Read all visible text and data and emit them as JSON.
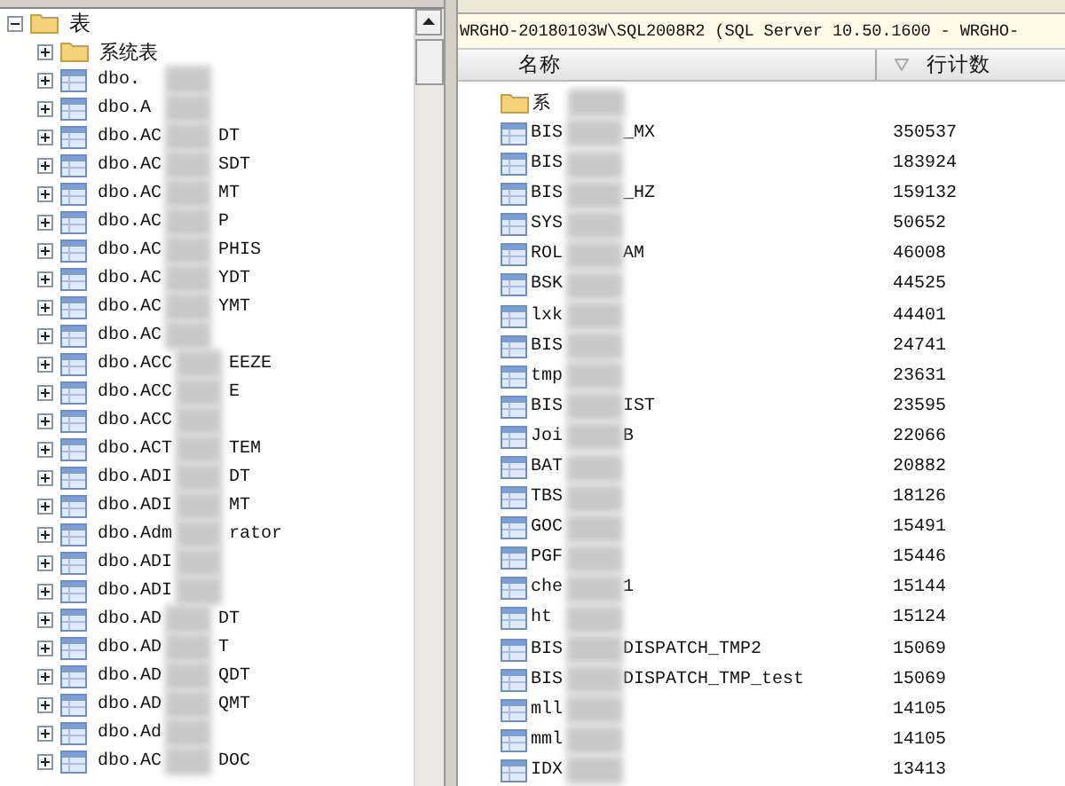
{
  "object_explorer": {
    "tree": [
      {
        "label": "表",
        "kind": "folder",
        "expanded": true,
        "children": [
          {
            "kind": "folder",
            "name_start": "系统表",
            "expanded": false
          },
          {
            "kind": "table",
            "name_start": "dbo.",
            "expanded": false
          },
          {
            "kind": "table",
            "name_start": "dbo.A",
            "expanded": false
          },
          {
            "kind": "table",
            "name_start": "dbo.AC",
            "name_end": "DT",
            "expanded": false
          },
          {
            "kind": "table",
            "name_start": "dbo.AC",
            "name_end": "SDT",
            "expanded": false
          },
          {
            "kind": "table",
            "name_start": "dbo.AC",
            "name_end": "MT",
            "expanded": false
          },
          {
            "kind": "table",
            "name_start": "dbo.AC",
            "name_end": "P",
            "expanded": false
          },
          {
            "kind": "table",
            "name_start": "dbo.AC",
            "name_end": "PHIS",
            "expanded": false
          },
          {
            "kind": "table",
            "name_start": "dbo.AC",
            "name_end": "YDT",
            "expanded": false
          },
          {
            "kind": "table",
            "name_start": "dbo.AC",
            "name_end": "YMT",
            "expanded": false
          },
          {
            "kind": "table",
            "name_start": "dbo.AC",
            "expanded": false
          },
          {
            "kind": "table",
            "name_start": "dbo.ACC",
            "name_end": "EEZE",
            "expanded": false
          },
          {
            "kind": "table",
            "name_start": "dbo.ACC",
            "name_end": "E",
            "expanded": false
          },
          {
            "kind": "table",
            "name_start": "dbo.ACC",
            "expanded": false
          },
          {
            "kind": "table",
            "name_start": "dbo.ACT",
            "name_end": "TEM",
            "expanded": false
          },
          {
            "kind": "table",
            "name_start": "dbo.ADI",
            "name_end": "DT",
            "expanded": false
          },
          {
            "kind": "table",
            "name_start": "dbo.ADI",
            "name_end": "MT",
            "expanded": false
          },
          {
            "kind": "table",
            "name_start": "dbo.Adm",
            "name_end": "rator",
            "expanded": false
          },
          {
            "kind": "table",
            "name_start": "dbo.ADI",
            "expanded": false
          },
          {
            "kind": "table",
            "name_start": "dbo.ADI",
            "expanded": false
          },
          {
            "kind": "table",
            "name_start": "dbo.AD",
            "name_end": "DT",
            "expanded": false
          },
          {
            "kind": "table",
            "name_start": "dbo.AD",
            "name_end": "T",
            "expanded": false
          },
          {
            "kind": "table",
            "name_start": "dbo.AD",
            "name_end": "QDT",
            "expanded": false
          },
          {
            "kind": "table",
            "name_start": "dbo.AD",
            "name_end": "QMT",
            "expanded": false
          },
          {
            "kind": "table",
            "name_start": "dbo.Ad",
            "expanded": false
          },
          {
            "kind": "table",
            "name_start": "dbo.AC",
            "name_end": "DOC",
            "expanded": false
          }
        ]
      }
    ]
  },
  "details": {
    "address_bar": "WRGHO-20180103W\\SQL2008R2 (SQL Server 10.50.1600 - WRGHO-",
    "columns": [
      "名称",
      "行计数"
    ],
    "rows": [
      {
        "kind": "folder",
        "name_start": "系"
      },
      {
        "kind": "table",
        "name_start": "BIS",
        "name_end": "_MX",
        "row_count": "350537"
      },
      {
        "kind": "table",
        "name_start": "BIS",
        "row_count": "183924"
      },
      {
        "kind": "table",
        "name_start": "BIS",
        "name_end": "_HZ",
        "row_count": "159132"
      },
      {
        "kind": "table",
        "name_start": "SYS",
        "row_count": "50652"
      },
      {
        "kind": "table",
        "name_start": "ROL",
        "name_end": "AM",
        "row_count": "46008"
      },
      {
        "kind": "table",
        "name_start": "BSK",
        "row_count": "44525"
      },
      {
        "kind": "table",
        "name_start": "lxk",
        "row_count": "44401"
      },
      {
        "kind": "table",
        "name_start": "BIS",
        "row_count": "24741"
      },
      {
        "kind": "table",
        "name_start": "tmp",
        "row_count": "23631"
      },
      {
        "kind": "table",
        "name_start": "BIS",
        "name_end": "IST",
        "row_count": "23595"
      },
      {
        "kind": "table",
        "name_start": "Joi",
        "name_end": "B",
        "row_count": "22066"
      },
      {
        "kind": "table",
        "name_start": "BAT",
        "row_count": "20882"
      },
      {
        "kind": "table",
        "name_start": "TBS",
        "row_count": "18126"
      },
      {
        "kind": "table",
        "name_start": "GOC",
        "row_count": "15491"
      },
      {
        "kind": "table",
        "name_start": "PGF",
        "row_count": "15446"
      },
      {
        "kind": "table",
        "name_start": "che",
        "name_end": "1",
        "row_count": "15144"
      },
      {
        "kind": "table",
        "name_start": "ht",
        "row_count": "15124"
      },
      {
        "kind": "table",
        "name_start": "BIS",
        "name_end": "DISPATCH_TMP2",
        "row_count": "15069"
      },
      {
        "kind": "table",
        "name_start": "BIS",
        "name_end": "DISPATCH_TMP_test",
        "row_count": "15069"
      },
      {
        "kind": "table",
        "name_start": "mll",
        "row_count": "14105"
      },
      {
        "kind": "table",
        "name_start": "mml",
        "row_count": "14105"
      },
      {
        "kind": "table",
        "name_start": "IDX",
        "row_count": "13413"
      }
    ]
  }
}
